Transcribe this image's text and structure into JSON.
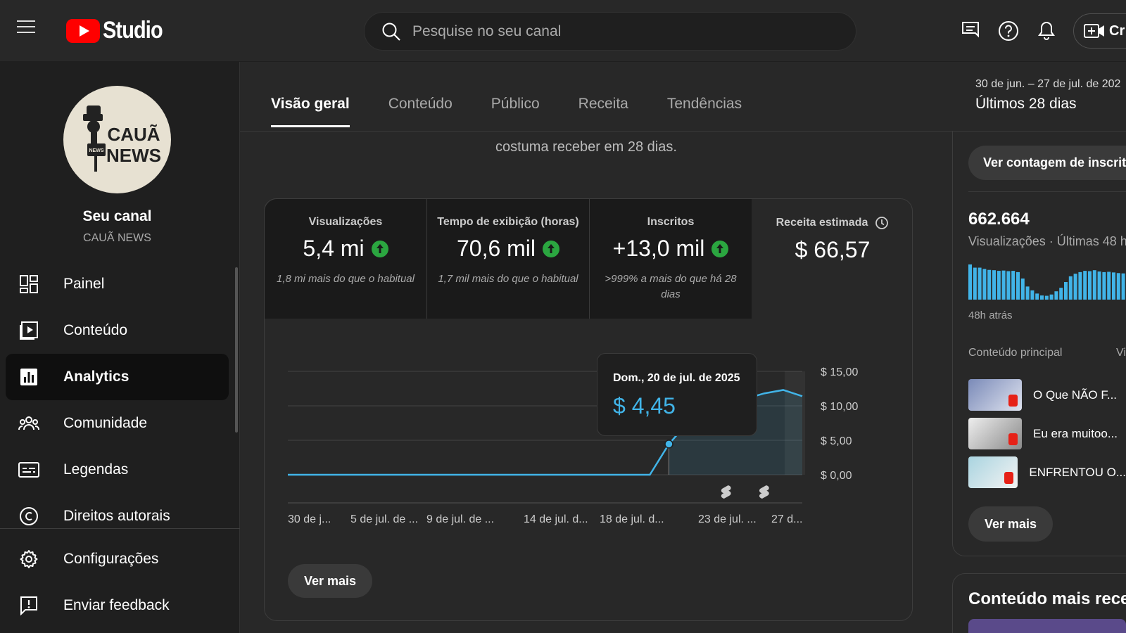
{
  "header": {
    "logo_text": "Studio",
    "search_placeholder": "Pesquise no seu canal",
    "create_label": "Cr"
  },
  "sidebar": {
    "avatar_text": [
      "CAUÃ",
      "NEWS"
    ],
    "avatar_badge": "NEWS",
    "channel_title": "Seu canal",
    "channel_name": "CAUÃ NEWS",
    "items": [
      {
        "label": "Painel",
        "icon": "dashboard-icon"
      },
      {
        "label": "Conteúdo",
        "icon": "content-icon"
      },
      {
        "label": "Analytics",
        "icon": "analytics-icon",
        "active": true
      },
      {
        "label": "Comunidade",
        "icon": "community-icon"
      },
      {
        "label": "Legendas",
        "icon": "subtitles-icon"
      },
      {
        "label": "Direitos autorais",
        "icon": "copyright-icon"
      }
    ],
    "bottom_items": [
      {
        "label": "Configurações",
        "icon": "settings-icon"
      },
      {
        "label": "Enviar feedback",
        "icon": "feedback-icon"
      }
    ]
  },
  "tabs": [
    "Visão geral",
    "Conteúdo",
    "Público",
    "Receita",
    "Tendências"
  ],
  "active_tab": "Visão geral",
  "date_range": "30 de jun. – 27 de jul. de 202",
  "range_label": "Últimos 28 dias",
  "intro_text": "costuma receber em 28 dias.",
  "metrics": [
    {
      "label": "Visualizações",
      "value": "5,4 mi",
      "trend": "up",
      "note": "1,8 mi mais do que o habitual"
    },
    {
      "label": "Tempo de exibição (horas)",
      "value": "70,6 mil",
      "trend": "up",
      "note": "1,7 mil mais do que o habitual"
    },
    {
      "label": "Inscritos",
      "value": "+13,0 mil",
      "trend": "up",
      "note": ">999% a mais do que há 28 dias"
    },
    {
      "label": "Receita estimada",
      "value": "$ 66,57",
      "trend": "none",
      "note": ""
    }
  ],
  "chart_data": {
    "type": "line",
    "metric": "Receita estimada",
    "x_labels": [
      "30 de j...",
      "5 de jul. de ...",
      "9 de jul. de ...",
      "14 de jul. d...",
      "18 de jul. d...",
      "23 de jul. ...",
      "27 d..."
    ],
    "y_ticks": [
      "$ 15,00",
      "$ 10,00",
      "$ 5,00",
      "$ 0,00"
    ],
    "ylim": [
      0,
      15
    ],
    "days": [
      "30/06",
      "01/07",
      "02/07",
      "03/07",
      "04/07",
      "05/07",
      "06/07",
      "07/07",
      "08/07",
      "09/07",
      "10/07",
      "11/07",
      "12/07",
      "13/07",
      "14/07",
      "15/07",
      "16/07",
      "17/07",
      "18/07",
      "19/07",
      "20/07",
      "21/07",
      "22/07",
      "23/07",
      "24/07",
      "25/07",
      "26/07",
      "27/07"
    ],
    "values": [
      0,
      0,
      0,
      0,
      0,
      0,
      0,
      0,
      0,
      0,
      0,
      0,
      0,
      0,
      0,
      0,
      0,
      0,
      0,
      0,
      4.45,
      7.6,
      9.0,
      10.0,
      11.0,
      11.8,
      12.3,
      11.4
    ],
    "highlight_index": 20,
    "shorts_markers": [
      23,
      25
    ],
    "accent": "#41b4e8"
  },
  "tooltip": {
    "date": "Dom., 20 de jul. de 2025",
    "value": "$ 4,45"
  },
  "see_more_label": "Ver mais",
  "realtime": {
    "button_label": "Ver contagem de inscrit",
    "number": "662.664",
    "subtitle": "Visualizações · Últimas 48 ho",
    "ago_label": "48h atrás",
    "top_content_label": "Conteúdo principal",
    "views_header": "Vi",
    "bars": [
      11,
      10,
      10,
      9.6,
      9.3,
      9.2,
      9.0,
      9.1,
      8.9,
      9.0,
      8.6,
      6.6,
      4.1,
      2.9,
      1.9,
      1.3,
      1.2,
      1.6,
      2.6,
      3.7,
      5.5,
      7.3,
      8.1,
      8.6,
      9.0,
      8.9,
      9.2,
      8.8,
      8.6,
      8.7,
      8.5,
      8.3,
      8.2
    ],
    "items": [
      {
        "title": "O Que NÃO F..."
      },
      {
        "title": "Eu era muitoo..."
      },
      {
        "title": "ENFRENTOU O..."
      }
    ],
    "see_more_label": "Ver mais",
    "recent_title": "Conteúdo mais recen"
  },
  "colors": {
    "bg": "#282828",
    "sidebar": "#1f1f1f",
    "accent": "#41b4e8",
    "up": "#2ba640",
    "youtube_red": "#ff0000"
  }
}
